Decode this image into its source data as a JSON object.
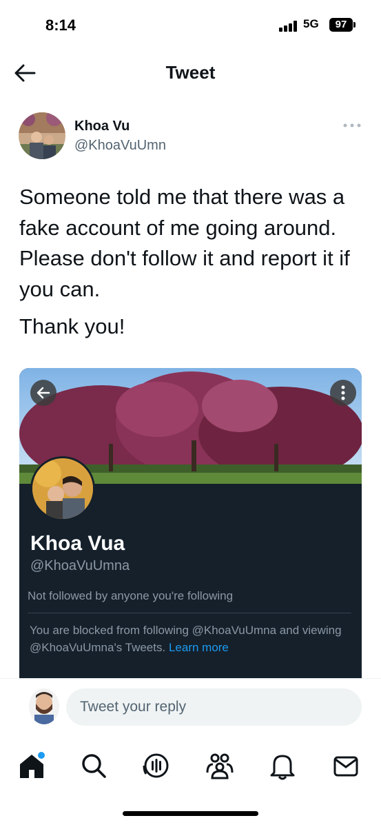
{
  "status_bar": {
    "time": "8:14",
    "network": "5G",
    "battery": "97"
  },
  "header": {
    "title": "Tweet",
    "back_icon": "arrow-left-icon"
  },
  "tweet": {
    "author": {
      "name": "Khoa Vu",
      "handle": "@KhoaVuUmn"
    },
    "more_icon": "more-dots-icon",
    "text_lines": "Someone told me that there was a fake account of me going around. Please don't follow it and report it if you can.",
    "text_closing": "Thank you!"
  },
  "embedded_screenshot": {
    "profile_name": "Khoa Vua",
    "profile_handle": "@KhoaVuUmna",
    "not_followed": "Not followed by anyone you're following",
    "blocked_text": "You are blocked from following @KhoaVuUmna and viewing @KhoaVuUmna's Tweets.",
    "learn_more": "Learn more"
  },
  "reply": {
    "placeholder": "Tweet your reply"
  },
  "tabs": [
    {
      "icon": "home-icon"
    },
    {
      "icon": "search-icon"
    },
    {
      "icon": "spaces-icon"
    },
    {
      "icon": "communities-icon"
    },
    {
      "icon": "notifications-icon"
    },
    {
      "icon": "messages-icon"
    }
  ],
  "colors": {
    "accent": "#1d9bf0",
    "dark_bg": "#15202b",
    "secondary_text": "#536471"
  }
}
